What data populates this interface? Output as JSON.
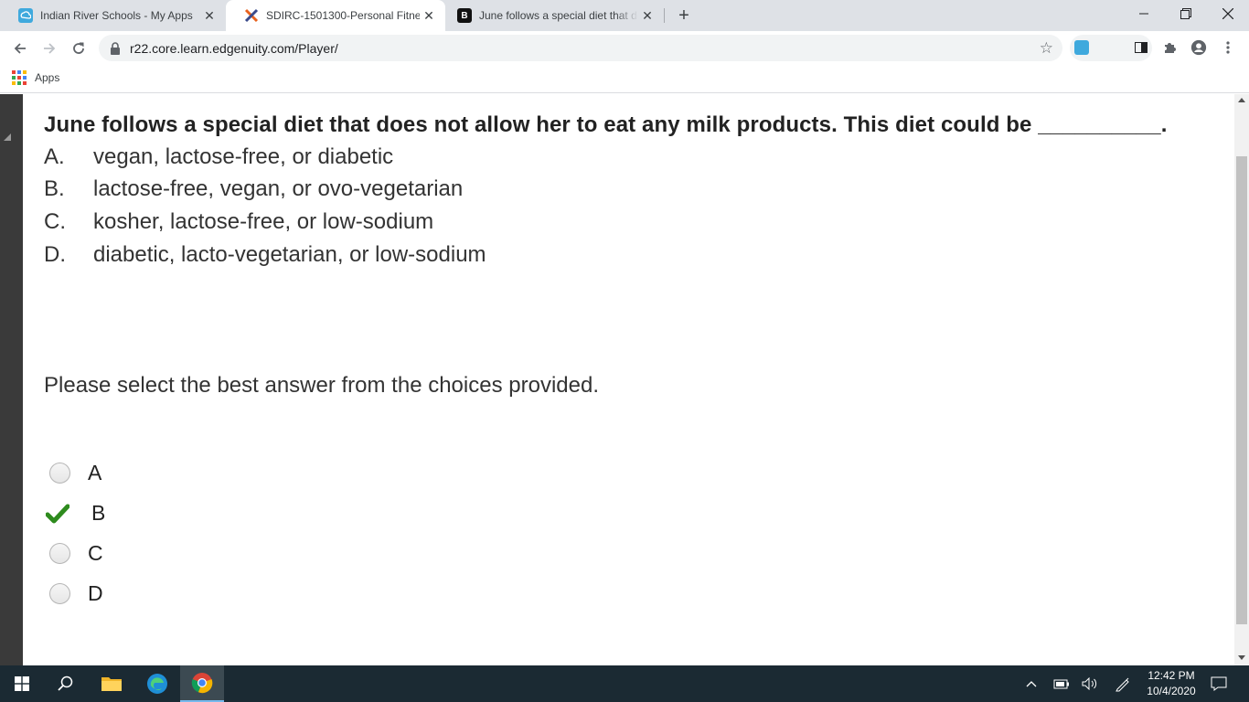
{
  "browser": {
    "tabs": [
      {
        "title": "Indian River Schools - My Apps",
        "icon": "classlink-icon"
      },
      {
        "title": "SDIRC-1501300-Personal Fitness",
        "icon": "edgenuity-icon"
      },
      {
        "title": "June follows a special diet that does not",
        "icon": "brainly-icon"
      }
    ],
    "url": "r22.core.learn.edgenuity.com/Player/",
    "bookmarks_apps_label": "Apps"
  },
  "question": {
    "text": "June follows a special diet that does not allow her to eat any milk products. This diet could be __________.",
    "choices": [
      {
        "letter": "A.",
        "text": "vegan, lactose-free, or diabetic"
      },
      {
        "letter": "B.",
        "text": "lactose-free, vegan, or ovo-vegetarian"
      },
      {
        "letter": "C.",
        "text": "kosher, lactose-free, or low-sodium"
      },
      {
        "letter": "D.",
        "text": "diabetic, lacto-vegetarian, or low-sodium"
      }
    ],
    "instruction": "Please select the best answer from the choices provided.",
    "options": [
      {
        "label": "A",
        "state": "unselected"
      },
      {
        "label": "B",
        "state": "correct-checked"
      },
      {
        "label": "C",
        "state": "unselected"
      },
      {
        "label": "D",
        "state": "unselected"
      }
    ]
  },
  "taskbar": {
    "time": "12:42 PM",
    "date": "10/4/2020"
  },
  "colors": {
    "check_green": "#2e8b1e",
    "taskbar_bg": "#1b2a33",
    "tab_strip_bg": "#dee1e6"
  }
}
